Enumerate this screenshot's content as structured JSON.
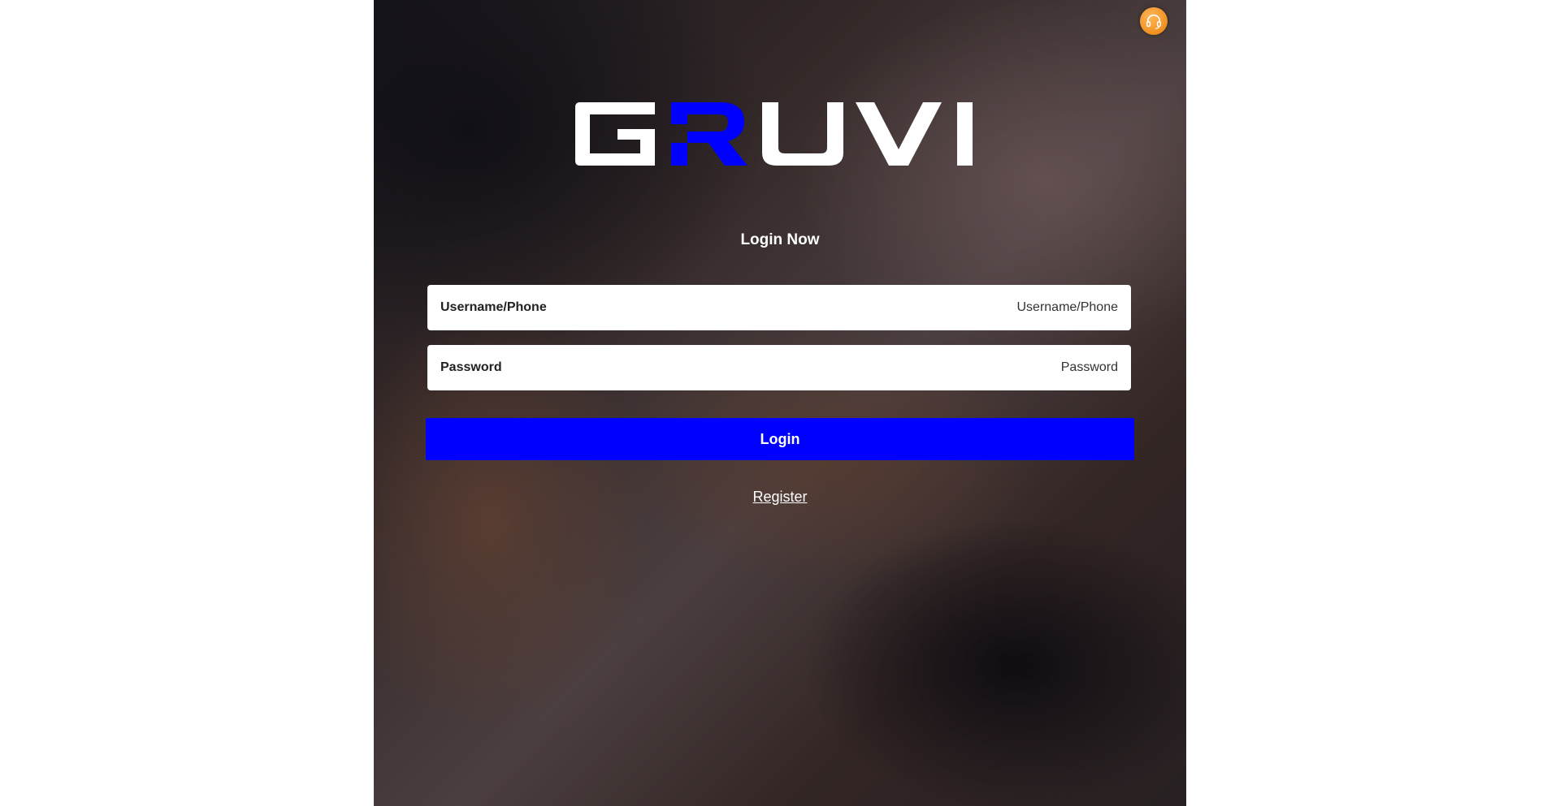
{
  "brand": {
    "name": "GRUVI",
    "accent_color": "#0000ff",
    "support_icon": "headset-icon"
  },
  "login": {
    "title": "Login Now",
    "username_label": "Username/Phone",
    "username_placeholder": "Username/Phone",
    "password_label": "Password",
    "password_placeholder": "Password",
    "submit_label": "Login",
    "register_label": "Register"
  },
  "colors": {
    "primary_button": "#0000ff",
    "support_button": "#f0901f"
  }
}
